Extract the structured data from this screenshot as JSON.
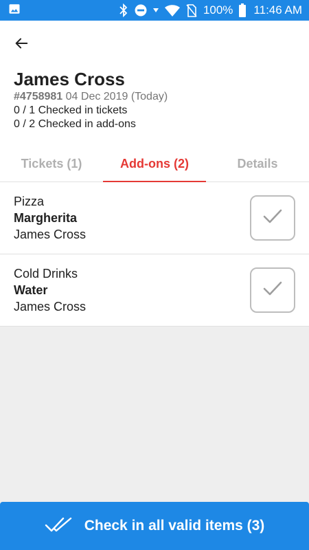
{
  "status_bar": {
    "battery": "100%",
    "time": "11:46 AM",
    "icons": [
      "image-icon",
      "bluetooth-icon",
      "do-not-disturb-icon",
      "data-arrow-icon",
      "wifi-icon",
      "no-sim-icon",
      "battery-icon"
    ]
  },
  "header": {
    "name": "James Cross",
    "order_number": "#4758981",
    "date": "04 Dec 2019 (Today)",
    "tickets_status": "0 / 1 Checked in tickets",
    "addons_status": "0 / 2 Checked in add-ons"
  },
  "tabs": [
    {
      "label": "Tickets (1)",
      "active": false
    },
    {
      "label": "Add-ons (2)",
      "active": true
    },
    {
      "label": "Details",
      "active": false
    }
  ],
  "items": [
    {
      "category": "Pizza",
      "name": "Margherita",
      "holder": "James Cross"
    },
    {
      "category": "Cold Drinks",
      "name": "Water",
      "holder": "James Cross"
    }
  ],
  "bottom_button": {
    "label": "Check in all valid items (3)",
    "icon": "double-check-icon"
  },
  "colors": {
    "primary": "#1e88e5",
    "accent": "#e53935"
  }
}
